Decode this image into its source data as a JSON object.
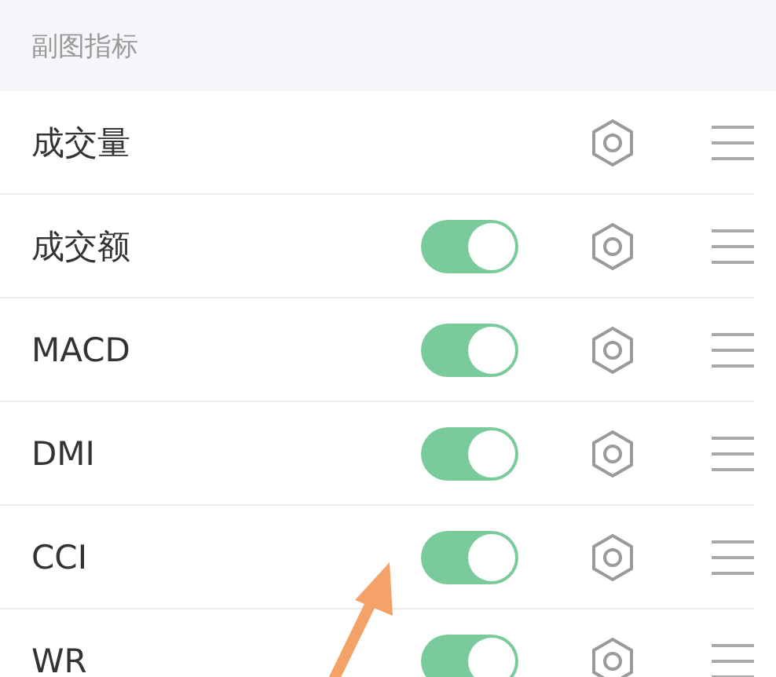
{
  "header": {
    "title": "副图指标"
  },
  "indicators": [
    {
      "name": "成交量",
      "kind": "fixed"
    },
    {
      "name": "成交额",
      "kind": "toggle",
      "on": true
    },
    {
      "name": "MACD",
      "kind": "toggle",
      "on": true
    },
    {
      "name": "DMI",
      "kind": "toggle",
      "on": true
    },
    {
      "name": "CCI",
      "kind": "toggle",
      "on": true
    },
    {
      "name": "WR",
      "kind": "toggle",
      "on": true
    }
  ]
}
